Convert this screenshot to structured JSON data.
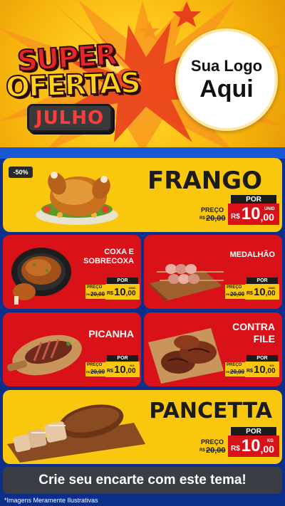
{
  "header": {
    "title_super": "SUPER",
    "title_ofertas": "OFERTAS",
    "month": "JULHO",
    "logo_line1": "Sua Logo",
    "logo_line2": "Aqui"
  },
  "colors": {
    "brand_yellow": "#f9c80e",
    "brand_red": "#d9121a",
    "brand_blue": "#1c58d6",
    "dark": "#1b1b1b"
  },
  "products": {
    "frango": {
      "name": "FRANGO",
      "discount": "-50%",
      "por_label": "POR",
      "old_label": "PREÇO",
      "old_prefix": "R$",
      "old_value": "20,00",
      "currency": "R$",
      "new_int": "10",
      "new_dec": ",00",
      "unit": "UNID"
    },
    "coxa": {
      "name_line1": "COXA E",
      "name_line2": "SOBRECOXA",
      "por_label": "POR",
      "old_label": "PREÇO",
      "old_prefix": "R$",
      "old_value": "20,00",
      "currency": "R$",
      "new_int": "10",
      "new_dec": ",00",
      "unit": "UNID"
    },
    "medalhao": {
      "name": "MEDALHÃO",
      "por_label": "POR",
      "old_label": "PREÇO",
      "old_prefix": "R$",
      "old_value": "20,00",
      "currency": "R$",
      "new_int": "10",
      "new_dec": ",00",
      "unit": "UNID"
    },
    "picanha": {
      "name": "PICANHA",
      "por_label": "POR",
      "old_label": "PREÇO",
      "old_prefix": "R$",
      "old_value": "20,00",
      "currency": "R$",
      "new_int": "10",
      "new_dec": ",00",
      "unit": "KG"
    },
    "contrafile": {
      "name_line1": "CONTRA",
      "name_line2": "FILE",
      "por_label": "POR",
      "old_label": "PREÇO",
      "old_prefix": "R$",
      "old_value": "20,00",
      "currency": "R$",
      "new_int": "10",
      "new_dec": ",00",
      "unit": "KG"
    },
    "pancetta": {
      "name": "PANCETTA",
      "por_label": "POR",
      "old_label": "PREÇO",
      "old_prefix": "R$",
      "old_value": "20,00",
      "currency": "R$",
      "new_int": "10",
      "new_dec": ",00",
      "unit": "KG"
    }
  },
  "cta": "Crie seu encarte com este tema!",
  "disclaimer": "*Imagens Meramente Ilustrativas"
}
